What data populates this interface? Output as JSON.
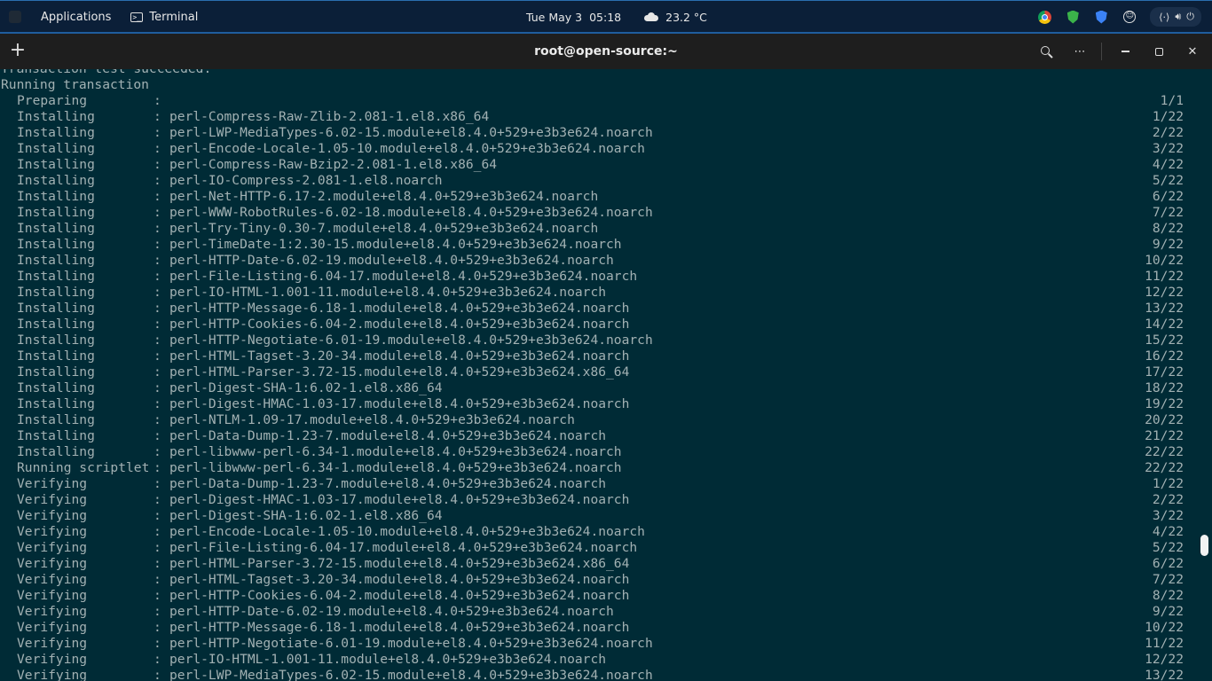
{
  "topbar": {
    "applications_label": "Applications",
    "terminal_label": "Terminal",
    "date": "Tue May 3",
    "time": "05:18",
    "weather": "23.2 °C",
    "icons": [
      "chrome-icon",
      "shield-icon",
      "shield2-icon",
      "accessibility-icon",
      "network-icon",
      "volume-icon",
      "power-icon"
    ]
  },
  "terminal": {
    "title": "root@open-source:~",
    "header_icons": [
      "plus-icon",
      "search-icon",
      "menu-icon",
      "minimize-icon",
      "maximize-icon",
      "close-icon"
    ],
    "close_glyph": "✕",
    "menu_glyph": "⋯",
    "plus_glyph": "+",
    "lines_plain": [
      "Transaction test succeeded.",
      "Running transaction"
    ],
    "rows": [
      {
        "action": "Preparing",
        "pkg": "",
        "prog": "1/1"
      },
      {
        "action": "Installing",
        "pkg": "perl-Compress-Raw-Zlib-2.081-1.el8.x86_64",
        "prog": "1/22"
      },
      {
        "action": "Installing",
        "pkg": "perl-LWP-MediaTypes-6.02-15.module+el8.4.0+529+e3b3e624.noarch",
        "prog": "2/22"
      },
      {
        "action": "Installing",
        "pkg": "perl-Encode-Locale-1.05-10.module+el8.4.0+529+e3b3e624.noarch",
        "prog": "3/22"
      },
      {
        "action": "Installing",
        "pkg": "perl-Compress-Raw-Bzip2-2.081-1.el8.x86_64",
        "prog": "4/22"
      },
      {
        "action": "Installing",
        "pkg": "perl-IO-Compress-2.081-1.el8.noarch",
        "prog": "5/22"
      },
      {
        "action": "Installing",
        "pkg": "perl-Net-HTTP-6.17-2.module+el8.4.0+529+e3b3e624.noarch",
        "prog": "6/22"
      },
      {
        "action": "Installing",
        "pkg": "perl-WWW-RobotRules-6.02-18.module+el8.4.0+529+e3b3e624.noarch",
        "prog": "7/22"
      },
      {
        "action": "Installing",
        "pkg": "perl-Try-Tiny-0.30-7.module+el8.4.0+529+e3b3e624.noarch",
        "prog": "8/22"
      },
      {
        "action": "Installing",
        "pkg": "perl-TimeDate-1:2.30-15.module+el8.4.0+529+e3b3e624.noarch",
        "prog": "9/22"
      },
      {
        "action": "Installing",
        "pkg": "perl-HTTP-Date-6.02-19.module+el8.4.0+529+e3b3e624.noarch",
        "prog": "10/22"
      },
      {
        "action": "Installing",
        "pkg": "perl-File-Listing-6.04-17.module+el8.4.0+529+e3b3e624.noarch",
        "prog": "11/22"
      },
      {
        "action": "Installing",
        "pkg": "perl-IO-HTML-1.001-11.module+el8.4.0+529+e3b3e624.noarch",
        "prog": "12/22"
      },
      {
        "action": "Installing",
        "pkg": "perl-HTTP-Message-6.18-1.module+el8.4.0+529+e3b3e624.noarch",
        "prog": "13/22"
      },
      {
        "action": "Installing",
        "pkg": "perl-HTTP-Cookies-6.04-2.module+el8.4.0+529+e3b3e624.noarch",
        "prog": "14/22"
      },
      {
        "action": "Installing",
        "pkg": "perl-HTTP-Negotiate-6.01-19.module+el8.4.0+529+e3b3e624.noarch",
        "prog": "15/22"
      },
      {
        "action": "Installing",
        "pkg": "perl-HTML-Tagset-3.20-34.module+el8.4.0+529+e3b3e624.noarch",
        "prog": "16/22"
      },
      {
        "action": "Installing",
        "pkg": "perl-HTML-Parser-3.72-15.module+el8.4.0+529+e3b3e624.x86_64",
        "prog": "17/22"
      },
      {
        "action": "Installing",
        "pkg": "perl-Digest-SHA-1:6.02-1.el8.x86_64",
        "prog": "18/22"
      },
      {
        "action": "Installing",
        "pkg": "perl-Digest-HMAC-1.03-17.module+el8.4.0+529+e3b3e624.noarch",
        "prog": "19/22"
      },
      {
        "action": "Installing",
        "pkg": "perl-NTLM-1.09-17.module+el8.4.0+529+e3b3e624.noarch",
        "prog": "20/22"
      },
      {
        "action": "Installing",
        "pkg": "perl-Data-Dump-1.23-7.module+el8.4.0+529+e3b3e624.noarch",
        "prog": "21/22"
      },
      {
        "action": "Installing",
        "pkg": "perl-libwww-perl-6.34-1.module+el8.4.0+529+e3b3e624.noarch",
        "prog": "22/22"
      },
      {
        "action": "Running scriptlet",
        "pkg": "perl-libwww-perl-6.34-1.module+el8.4.0+529+e3b3e624.noarch",
        "prog": "22/22"
      },
      {
        "action": "Verifying",
        "pkg": "perl-Data-Dump-1.23-7.module+el8.4.0+529+e3b3e624.noarch",
        "prog": "1/22"
      },
      {
        "action": "Verifying",
        "pkg": "perl-Digest-HMAC-1.03-17.module+el8.4.0+529+e3b3e624.noarch",
        "prog": "2/22"
      },
      {
        "action": "Verifying",
        "pkg": "perl-Digest-SHA-1:6.02-1.el8.x86_64",
        "prog": "3/22"
      },
      {
        "action": "Verifying",
        "pkg": "perl-Encode-Locale-1.05-10.module+el8.4.0+529+e3b3e624.noarch",
        "prog": "4/22"
      },
      {
        "action": "Verifying",
        "pkg": "perl-File-Listing-6.04-17.module+el8.4.0+529+e3b3e624.noarch",
        "prog": "5/22"
      },
      {
        "action": "Verifying",
        "pkg": "perl-HTML-Parser-3.72-15.module+el8.4.0+529+e3b3e624.x86_64",
        "prog": "6/22"
      },
      {
        "action": "Verifying",
        "pkg": "perl-HTML-Tagset-3.20-34.module+el8.4.0+529+e3b3e624.noarch",
        "prog": "7/22"
      },
      {
        "action": "Verifying",
        "pkg": "perl-HTTP-Cookies-6.04-2.module+el8.4.0+529+e3b3e624.noarch",
        "prog": "8/22"
      },
      {
        "action": "Verifying",
        "pkg": "perl-HTTP-Date-6.02-19.module+el8.4.0+529+e3b3e624.noarch",
        "prog": "9/22"
      },
      {
        "action": "Verifying",
        "pkg": "perl-HTTP-Message-6.18-1.module+el8.4.0+529+e3b3e624.noarch",
        "prog": "10/22"
      },
      {
        "action": "Verifying",
        "pkg": "perl-HTTP-Negotiate-6.01-19.module+el8.4.0+529+e3b3e624.noarch",
        "prog": "11/22"
      },
      {
        "action": "Verifying",
        "pkg": "perl-IO-HTML-1.001-11.module+el8.4.0+529+e3b3e624.noarch",
        "prog": "12/22"
      },
      {
        "action": "Verifying",
        "pkg": "perl-LWP-MediaTypes-6.02-15.module+el8.4.0+529+e3b3e624.noarch",
        "prog": "13/22"
      }
    ]
  },
  "colors": {
    "terminal_bg": "#002b36",
    "terminal_fg": "#a2b1b3",
    "header_bg": "#1e1e1e",
    "topbar_bg": "#0b1f38"
  }
}
